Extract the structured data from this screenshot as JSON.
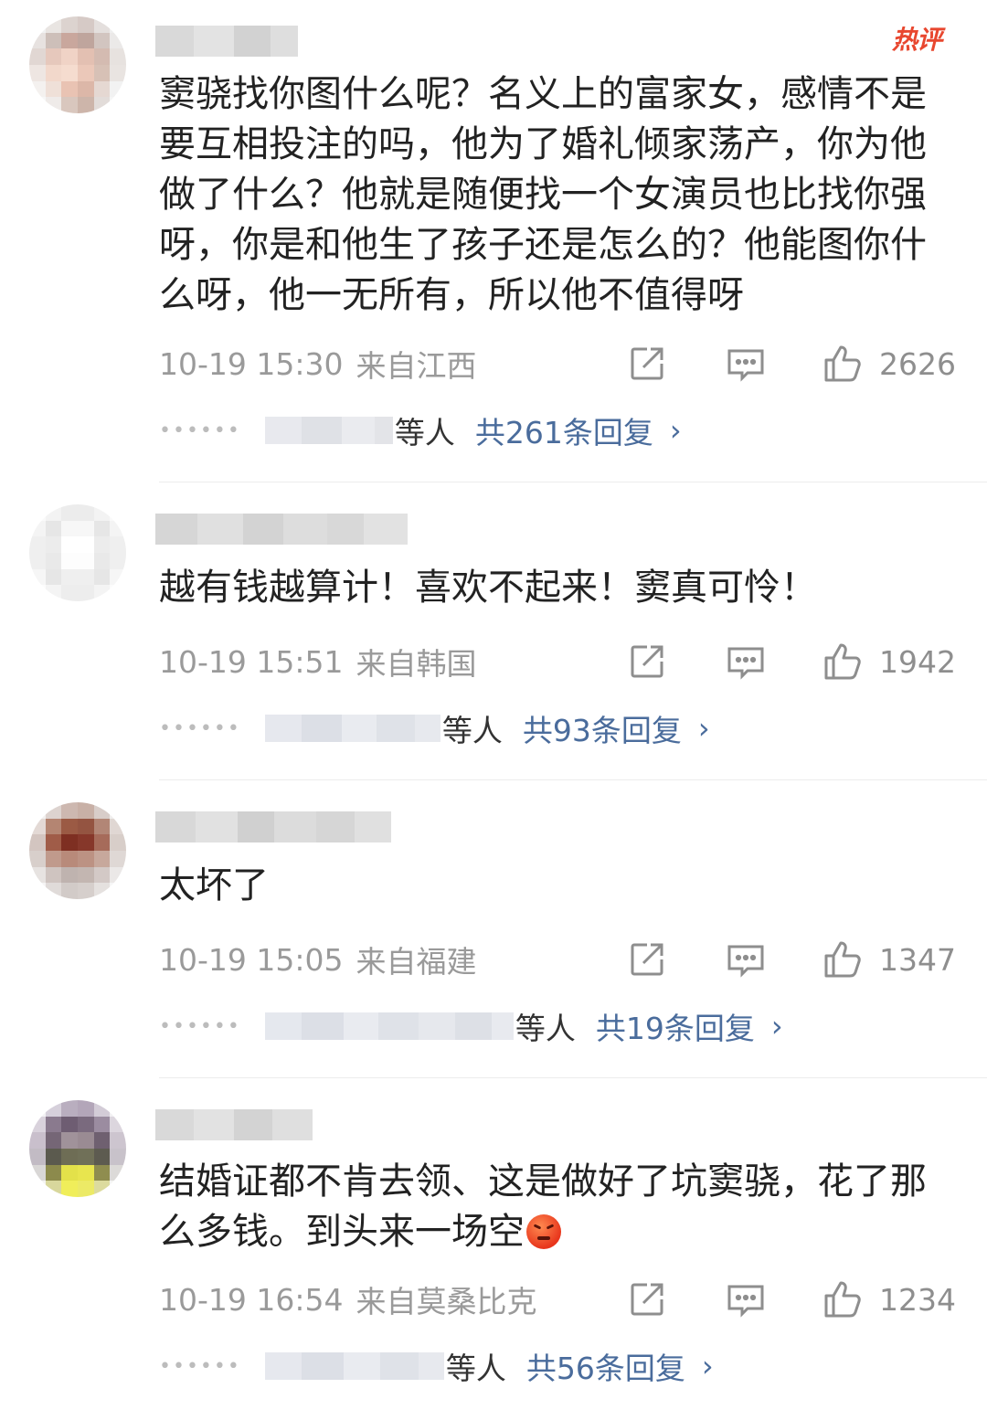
{
  "hot_badge": "热评",
  "comments": [
    {
      "text": "窦骁找你图什么呢？名义上的富家女，感情不是要互相投注的吗，他为了婚礼倾家荡产，你为他做了什么？他就是随便找一个女演员也比找你强呀，你是和他生了孩子还是怎么的？他能图你什么呀，他一无所有，所以他不值得呀",
      "time": "10-19 15:30",
      "location": "来自江西",
      "likes": "2626",
      "replies_suffix": "等人",
      "replies_total": "共261条回复"
    },
    {
      "text": "越有钱越算计！喜欢不起来！窦真可怜！",
      "time": "10-19 15:51",
      "location": "来自韩国",
      "likes": "1942",
      "replies_suffix": "等人",
      "replies_total": "共93条回复"
    },
    {
      "text": "太坏了",
      "time": "10-19 15:05",
      "location": "来自福建",
      "likes": "1347",
      "replies_suffix": "等人",
      "replies_total": "共19条回复"
    },
    {
      "text": "结婚证都不肯去领、这是做好了坑窦骁，花了那么多钱。到头来一场空",
      "time": "10-19 16:54",
      "location": "来自莫桑比克",
      "likes": "1234",
      "replies_suffix": "等人",
      "replies_total": "共56条回复"
    }
  ],
  "icons": {
    "repost": "repost-icon",
    "comment": "comment-icon",
    "like": "thumbs-up-icon",
    "emoji": "angry-face-emoji"
  },
  "colors": {
    "text": "#222222",
    "meta": "#9a9a9a",
    "link": "#4a6c9c",
    "hot": "#e8472f"
  }
}
